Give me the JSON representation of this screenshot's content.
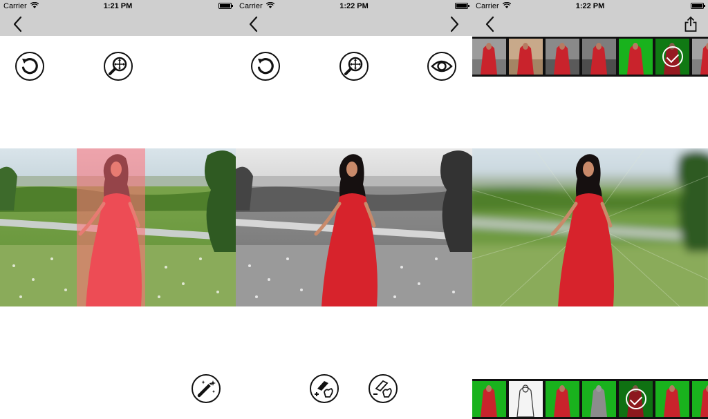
{
  "status": {
    "carrier": "Carrier",
    "times": [
      "1:21 PM",
      "1:22 PM",
      "1:22 PM"
    ]
  },
  "icons": {
    "back": "chevron-left-icon",
    "forward": "chevron-right-icon",
    "share": "share-icon",
    "undo": "undo-icon",
    "zoom": "zoom-move-icon",
    "preview": "eye-icon",
    "magic_wand": "magic-wand-icon",
    "brush_add": "brush-add-icon",
    "brush_remove": "brush-remove-icon"
  },
  "colors": {
    "bar": "#cfcfcf",
    "dress": "#d7232c",
    "overlay": "#ff6f78",
    "strip_green": "#19b21d",
    "icon": "#111111"
  },
  "filter_strips": {
    "top": {
      "count": 7,
      "selected": 5
    },
    "bottom": {
      "count": 7,
      "selected": 4
    }
  }
}
